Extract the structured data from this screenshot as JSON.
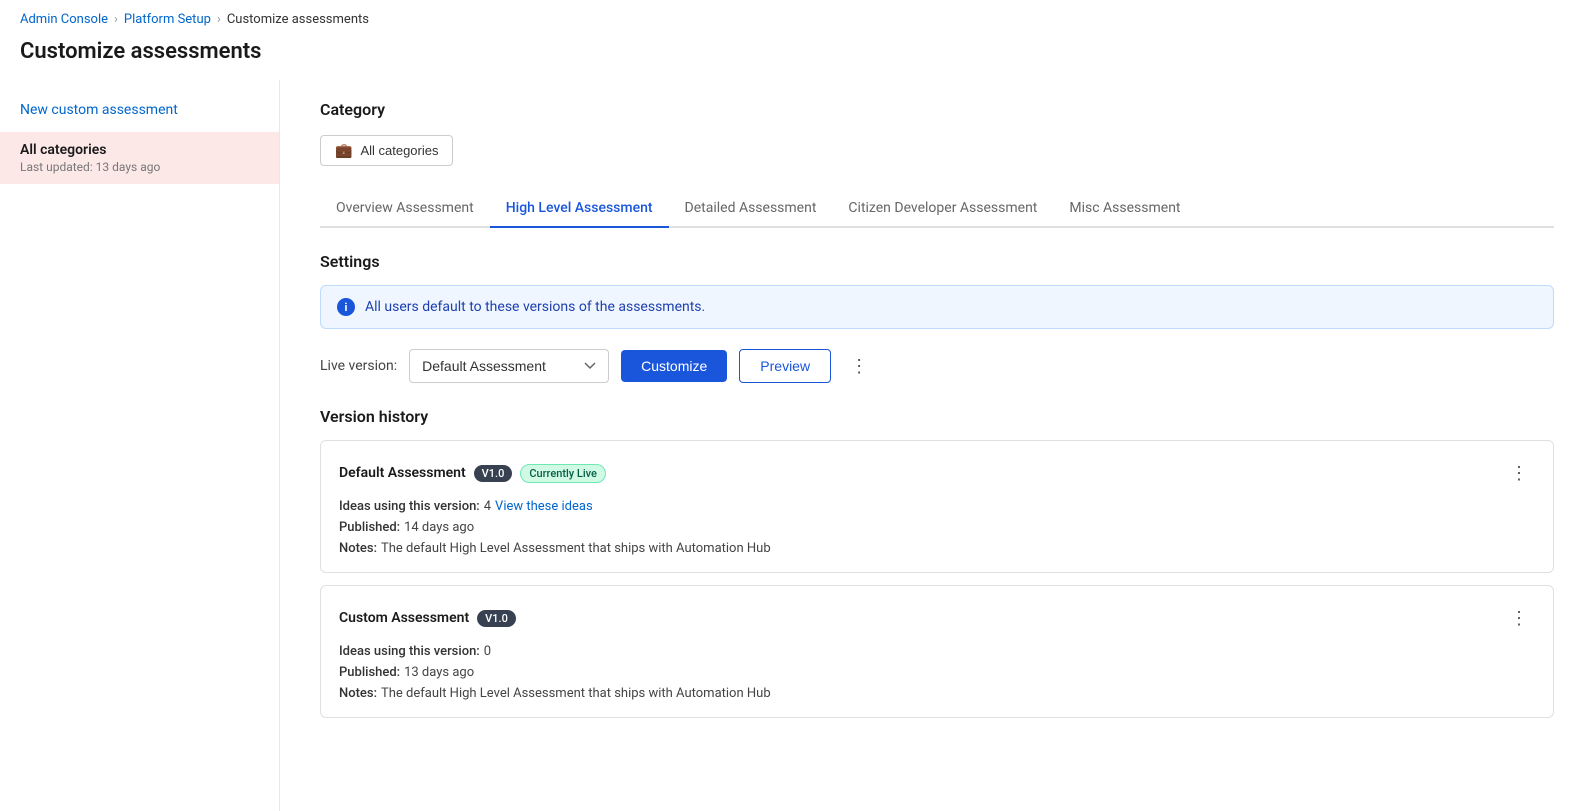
{
  "breadcrumb": {
    "items": [
      {
        "label": "Admin Console",
        "link": true
      },
      {
        "label": "Platform Setup",
        "link": true
      },
      {
        "label": "Customize assessments",
        "link": false
      }
    ]
  },
  "page": {
    "title": "Customize assessments"
  },
  "sidebar": {
    "new_link": "New custom assessment",
    "items": [
      {
        "name": "All categories",
        "meta": "Last updated: 13 days ago",
        "active": true
      }
    ]
  },
  "main": {
    "category_label": "Category",
    "category_button": "All categories",
    "tabs": [
      {
        "label": "Overview Assessment",
        "active": false
      },
      {
        "label": "High Level Assessment",
        "active": true
      },
      {
        "label": "Detailed Assessment",
        "active": false
      },
      {
        "label": "Citizen Developer Assessment",
        "active": false
      },
      {
        "label": "Misc Assessment",
        "active": false
      }
    ],
    "settings": {
      "title": "Settings",
      "info_message": "All users default to these versions of the assessments.",
      "live_version_label": "Live version:",
      "live_version_value": "Default Assessment",
      "btn_customize": "Customize",
      "btn_preview": "Preview"
    },
    "version_history": {
      "title": "Version history",
      "cards": [
        {
          "name": "Default Assessment",
          "version_badge": "V1.0",
          "live_badge": "Currently Live",
          "ideas_label": "Ideas using this version:",
          "ideas_count": "4",
          "view_ideas_label": "View these ideas",
          "published_label": "Published:",
          "published_date": "14 days ago",
          "notes_label": "Notes:",
          "notes_text": "The default High Level Assessment that ships with Automation Hub"
        },
        {
          "name": "Custom Assessment",
          "version_badge": "V1.0",
          "live_badge": null,
          "ideas_label": "Ideas using this version:",
          "ideas_count": "0",
          "view_ideas_label": null,
          "published_label": "Published:",
          "published_date": "13 days ago",
          "notes_label": "Notes:",
          "notes_text": "The default High Level Assessment that ships with Automation Hub"
        }
      ]
    }
  }
}
